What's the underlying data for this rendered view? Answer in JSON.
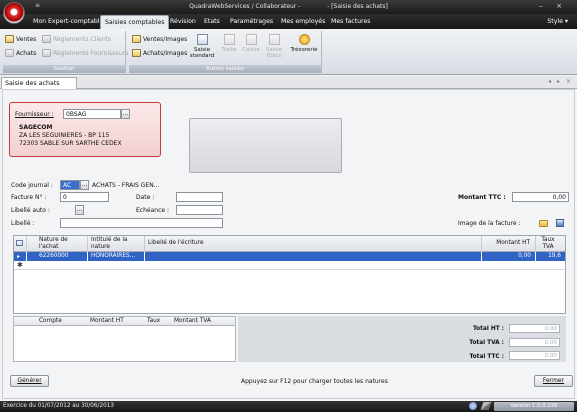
{
  "window": {
    "title": "QuadraWebServices / Collaborateur -              - [Saisie des achats]",
    "quick_access": "≡",
    "controls": {
      "minimize": "–",
      "close": "×"
    }
  },
  "menubar": {
    "items": [
      "Mon Expert-comptable",
      "Saisies comptables",
      "Révision",
      "Etats",
      "Paramétrages",
      "Mes employés",
      "Mes factures"
    ],
    "active": "Saisies comptables",
    "style_label": "Style ▾"
  },
  "ribbon": {
    "gestion": {
      "label": "Gestion",
      "ventes": "Ventes",
      "achats": "Achats",
      "reglements_clients": "Règlements Clients",
      "reglements_fournisseurs": "Règlements Fournisseurs"
    },
    "autres_saisies": {
      "label": "Autres saisies",
      "ventes_images": "Ventes/Images",
      "achats_images": "Achats/Images",
      "saisie_standard": "Saisie standard",
      "traite": "Traite",
      "caisse": "Caisse",
      "saisie_ebics": "Saisie Ebics",
      "tresorerie": "Trésorerie"
    }
  },
  "doc_tab": {
    "label": "Saisie des achats",
    "nav": "◂ ▸ ×"
  },
  "supplier": {
    "label": "Fournisseur :",
    "code": "0BSAG",
    "pick": "...",
    "name": "SAGECOM",
    "address1": "ZA LES SEGUINIERES - BP 115",
    "address2": "72303 SABLE SUR SARTHE CEDEX"
  },
  "form": {
    "code_journal_label": "Code journal :",
    "code_journal_value": "AC",
    "journal_name": "ACHATS - FRAIS GEN...",
    "facture_label": "Facture N° :",
    "facture_value": "0",
    "date_label": "Date :",
    "libelle_auto_label": "Libellé auto :",
    "echeance_label": "Echéance :",
    "libelle_label": "Libellé :",
    "montant_ttc_label": "Montant TTC :",
    "montant_ttc_value": "0,00",
    "image_label": "Image de la facture :",
    "pick": "..."
  },
  "grid": {
    "headers": [
      "Nature de l'achat",
      "Intitulé de la nature",
      "Libellé de l'écriture",
      "Montant HT",
      "Taux TVA"
    ],
    "rows": [
      {
        "pointer": "▸",
        "nature": "62260000",
        "intitule": "HONORAIRES...",
        "libelle": "",
        "montant_ht": "0,00",
        "taux_tva": "19,6"
      }
    ],
    "new_row_marker": "✱"
  },
  "subgrid": {
    "headers": [
      "Compte",
      "Montant HT",
      "Taux",
      "Montant TVA"
    ]
  },
  "totals": {
    "total_ht_label": "Total HT :",
    "total_ht_value": "0,00",
    "total_tva_label": "Total TVA :",
    "total_tva_value": "0,00",
    "total_ttc_label": "Total TTC :",
    "total_ttc_value": "0,00"
  },
  "footer": {
    "generer": "Générer",
    "hint": "Appuyez sur F12 pour charger toutes les natures",
    "fermer": "Fermer"
  },
  "statusbar": {
    "exercise": "Exercice du 01/07/2012 au 30/06/2013",
    "version": "Version 1.0.0.226"
  },
  "colors": {
    "accent_selection": "#2f63c4",
    "supplier_border": "#c23a3a",
    "dark_chrome": "#1b1b1b"
  }
}
